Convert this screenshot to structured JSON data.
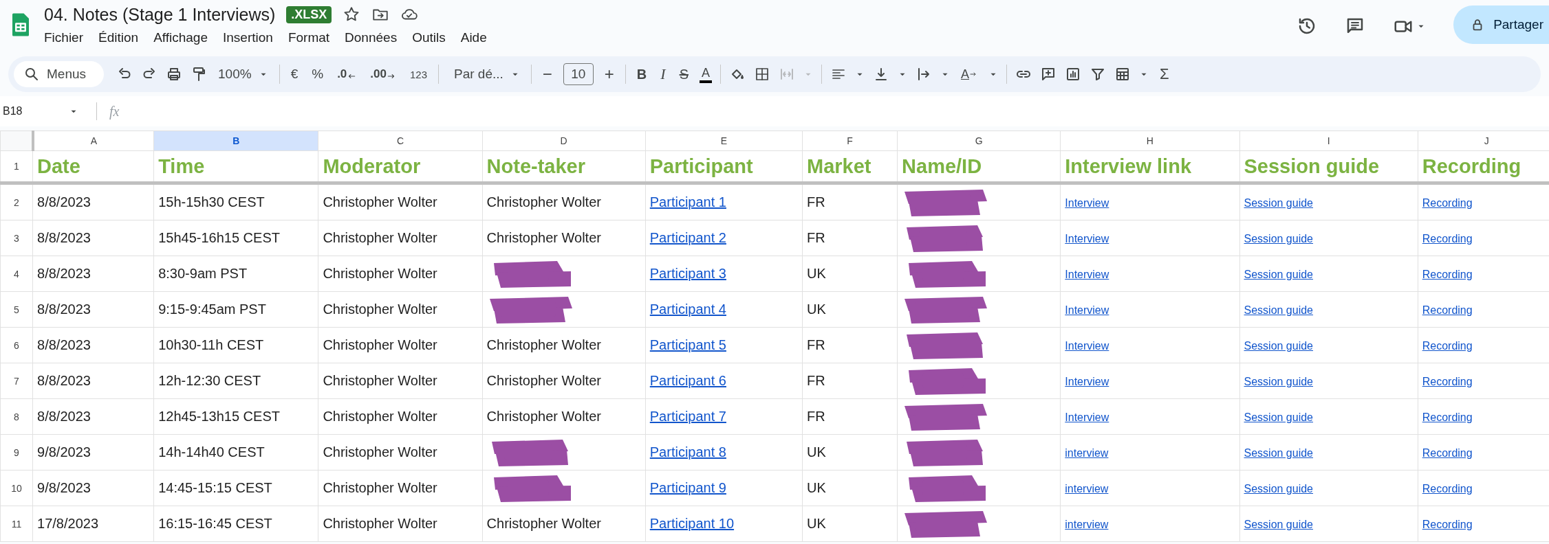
{
  "document": {
    "title": "04. Notes (Stage 1 Interviews)",
    "badge": ".XLSX"
  },
  "menu": [
    "Fichier",
    "Édition",
    "Affichage",
    "Insertion",
    "Format",
    "Données",
    "Outils",
    "Aide"
  ],
  "share_button": {
    "label": "Partager"
  },
  "toolbar": {
    "search_label": "Menus",
    "zoom": "100%",
    "currency": "€",
    "percent": "%",
    "decimal_decrease": ".0",
    "decimal_increase": ".00",
    "number_format": "123",
    "font": "Par dé...",
    "font_size_minus": "−",
    "font_size": "10",
    "font_size_plus": "+",
    "bold": "B",
    "italic": "I",
    "strikethrough": "S",
    "text_color": "A",
    "text_rotation": "A",
    "sum": "Σ"
  },
  "formula_bar": {
    "cell_ref": "B18",
    "label": "fx"
  },
  "columns": [
    {
      "letter": "A",
      "selected": false
    },
    {
      "letter": "B",
      "selected": true
    },
    {
      "letter": "C",
      "selected": false
    },
    {
      "letter": "D",
      "selected": false
    },
    {
      "letter": "E",
      "selected": false
    },
    {
      "letter": "F",
      "selected": false
    },
    {
      "letter": "G",
      "selected": false
    },
    {
      "letter": "H",
      "selected": false
    },
    {
      "letter": "I",
      "selected": false
    },
    {
      "letter": "J",
      "selected": false
    }
  ],
  "header_row": {
    "number": "1",
    "cells": [
      "Date",
      "Time",
      "Moderator",
      "Note-taker",
      "Participant",
      "Market",
      "Name/ID",
      "Interview link",
      "Session guide",
      "Recording"
    ]
  },
  "rows": [
    {
      "number": "2",
      "cells": [
        {
          "kind": "text",
          "text": "8/8/2023"
        },
        {
          "kind": "text",
          "text": "15h-15h30 CEST"
        },
        {
          "kind": "text",
          "text": "Christopher Wolter"
        },
        {
          "kind": "text",
          "text": "Christopher Wolter"
        },
        {
          "kind": "link",
          "text": "Participant 1"
        },
        {
          "kind": "text",
          "text": "FR"
        },
        {
          "kind": "redacted"
        },
        {
          "kind": "small-link",
          "text": "Interview"
        },
        {
          "kind": "small-link",
          "text": "Session guide"
        },
        {
          "kind": "small-link",
          "text": "Recording"
        }
      ]
    },
    {
      "number": "3",
      "cells": [
        {
          "kind": "text",
          "text": "8/8/2023"
        },
        {
          "kind": "text",
          "text": "15h45-16h15 CEST"
        },
        {
          "kind": "text",
          "text": "Christopher Wolter"
        },
        {
          "kind": "text",
          "text": "Christopher Wolter"
        },
        {
          "kind": "link",
          "text": "Participant 2"
        },
        {
          "kind": "text",
          "text": "FR"
        },
        {
          "kind": "redacted"
        },
        {
          "kind": "small-link",
          "text": "Interview"
        },
        {
          "kind": "small-link",
          "text": "Session guide"
        },
        {
          "kind": "small-link",
          "text": "Recording"
        }
      ]
    },
    {
      "number": "4",
      "cells": [
        {
          "kind": "text",
          "text": "8/8/2023"
        },
        {
          "kind": "text",
          "text": "8:30-9am PST"
        },
        {
          "kind": "text",
          "text": "Christopher Wolter"
        },
        {
          "kind": "redacted"
        },
        {
          "kind": "link",
          "text": "Participant 3"
        },
        {
          "kind": "text",
          "text": "UK"
        },
        {
          "kind": "redacted"
        },
        {
          "kind": "small-link",
          "text": "Interview"
        },
        {
          "kind": "small-link",
          "text": "Session guide"
        },
        {
          "kind": "small-link",
          "text": "Recording"
        }
      ]
    },
    {
      "number": "5",
      "cells": [
        {
          "kind": "text",
          "text": "8/8/2023"
        },
        {
          "kind": "text",
          "text": "9:15-9:45am PST"
        },
        {
          "kind": "text",
          "text": "Christopher Wolter"
        },
        {
          "kind": "redacted"
        },
        {
          "kind": "link",
          "text": "Participant 4"
        },
        {
          "kind": "text",
          "text": "UK"
        },
        {
          "kind": "redacted"
        },
        {
          "kind": "small-link",
          "text": "Interview"
        },
        {
          "kind": "small-link",
          "text": "Session guide"
        },
        {
          "kind": "small-link",
          "text": "Recording"
        }
      ]
    },
    {
      "number": "6",
      "cells": [
        {
          "kind": "text",
          "text": "8/8/2023"
        },
        {
          "kind": "text",
          "text": "10h30-11h CEST"
        },
        {
          "kind": "text",
          "text": "Christopher Wolter"
        },
        {
          "kind": "text",
          "text": "Christopher Wolter"
        },
        {
          "kind": "link",
          "text": "Participant 5"
        },
        {
          "kind": "text",
          "text": "FR"
        },
        {
          "kind": "redacted"
        },
        {
          "kind": "small-link",
          "text": "Interview"
        },
        {
          "kind": "small-link",
          "text": "Session guide"
        },
        {
          "kind": "small-link",
          "text": "Recording"
        }
      ]
    },
    {
      "number": "7",
      "cells": [
        {
          "kind": "text",
          "text": "8/8/2023"
        },
        {
          "kind": "text",
          "text": "12h-12:30 CEST"
        },
        {
          "kind": "text",
          "text": "Christopher Wolter"
        },
        {
          "kind": "text",
          "text": "Christopher Wolter"
        },
        {
          "kind": "link",
          "text": "Participant 6"
        },
        {
          "kind": "text",
          "text": "FR"
        },
        {
          "kind": "redacted"
        },
        {
          "kind": "small-link",
          "text": "Interview"
        },
        {
          "kind": "small-link",
          "text": "Session guide"
        },
        {
          "kind": "small-link",
          "text": "Recording"
        }
      ]
    },
    {
      "number": "8",
      "cells": [
        {
          "kind": "text",
          "text": "8/8/2023"
        },
        {
          "kind": "text",
          "text": "12h45-13h15 CEST"
        },
        {
          "kind": "text",
          "text": "Christopher Wolter"
        },
        {
          "kind": "text",
          "text": "Christopher Wolter"
        },
        {
          "kind": "link",
          "text": "Participant 7"
        },
        {
          "kind": "text",
          "text": "FR"
        },
        {
          "kind": "redacted"
        },
        {
          "kind": "small-link",
          "text": "Interview"
        },
        {
          "kind": "small-link",
          "text": "Session guide"
        },
        {
          "kind": "small-link",
          "text": "Recording"
        }
      ]
    },
    {
      "number": "9",
      "cells": [
        {
          "kind": "text",
          "text": "9/8/2023"
        },
        {
          "kind": "text",
          "text": "14h-14h40 CEST"
        },
        {
          "kind": "text",
          "text": "Christopher Wolter"
        },
        {
          "kind": "redacted"
        },
        {
          "kind": "link",
          "text": "Participant 8"
        },
        {
          "kind": "text",
          "text": "UK"
        },
        {
          "kind": "redacted"
        },
        {
          "kind": "small-link",
          "text": "interview"
        },
        {
          "kind": "small-link",
          "text": "Session guide"
        },
        {
          "kind": "small-link",
          "text": "Recording"
        }
      ]
    },
    {
      "number": "10",
      "cells": [
        {
          "kind": "text",
          "text": "9/8/2023"
        },
        {
          "kind": "text",
          "text": "14:45-15:15 CEST"
        },
        {
          "kind": "text",
          "text": "Christopher Wolter"
        },
        {
          "kind": "redacted"
        },
        {
          "kind": "link",
          "text": "Participant 9"
        },
        {
          "kind": "text",
          "text": "UK"
        },
        {
          "kind": "redacted"
        },
        {
          "kind": "small-link",
          "text": "interview"
        },
        {
          "kind": "small-link",
          "text": "Session guide"
        },
        {
          "kind": "small-link",
          "text": "Recording"
        }
      ]
    },
    {
      "number": "11",
      "cells": [
        {
          "kind": "text",
          "text": "17/8/2023"
        },
        {
          "kind": "text",
          "text": "16:15-16:45 CEST"
        },
        {
          "kind": "text",
          "text": "Christopher Wolter"
        },
        {
          "kind": "text",
          "text": "Christopher Wolter"
        },
        {
          "kind": "link",
          "text": "Participant 10"
        },
        {
          "kind": "text",
          "text": "UK"
        },
        {
          "kind": "redacted"
        },
        {
          "kind": "small-link",
          "text": "interview"
        },
        {
          "kind": "small-link",
          "text": "Session guide"
        },
        {
          "kind": "small-link",
          "text": "Recording"
        }
      ]
    }
  ]
}
